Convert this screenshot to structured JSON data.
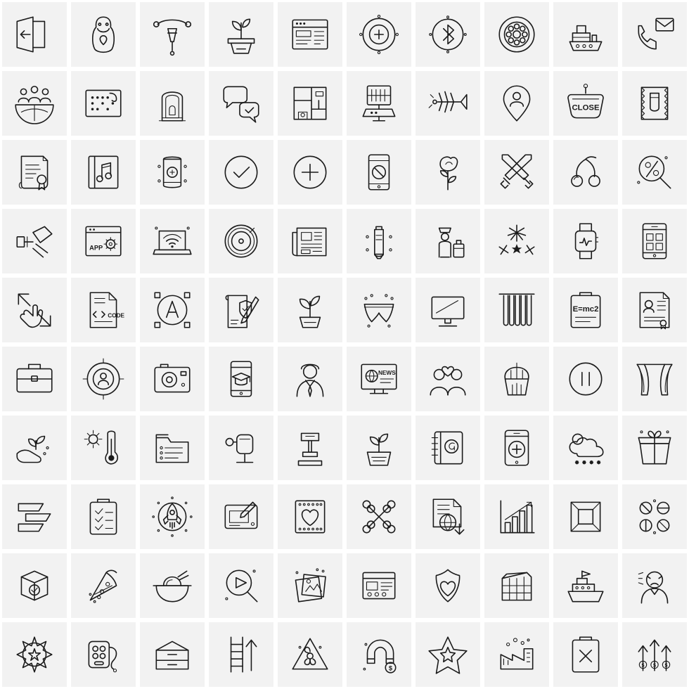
{
  "sheet": {
    "title": "Line Icon Set",
    "columns": 10,
    "rows": 10,
    "cell_background": "#f2f2f2",
    "page_background": "#ffffff",
    "stroke_color": "#1b1b1b",
    "icons": [
      {
        "row": 1,
        "col": 1,
        "name": "exit-left-arrow-icon",
        "label": "Exit Left Arrow"
      },
      {
        "row": 1,
        "col": 2,
        "name": "matryoshka-doll-icon",
        "label": "Matryoshka Doll"
      },
      {
        "row": 1,
        "col": 3,
        "name": "pen-tool-node-icon",
        "label": "Pen Tool Node"
      },
      {
        "row": 1,
        "col": 4,
        "name": "potted-plant-icon",
        "label": "Potted Plant"
      },
      {
        "row": 1,
        "col": 5,
        "name": "browser-window-icon",
        "label": "Browser Window"
      },
      {
        "row": 1,
        "col": 6,
        "name": "add-circle-target-icon",
        "label": "Add Circle Target"
      },
      {
        "row": 1,
        "col": 7,
        "name": "bluetooth-icon",
        "label": "Bluetooth"
      },
      {
        "row": 1,
        "col": 8,
        "name": "flower-circle-icon",
        "label": "Flower Circle"
      },
      {
        "row": 1,
        "col": 9,
        "name": "ship-icon",
        "label": "Ship"
      },
      {
        "row": 1,
        "col": 10,
        "name": "phone-mail-icon",
        "label": "Phone Mail"
      },
      {
        "row": 2,
        "col": 1,
        "name": "global-team-icon",
        "label": "Global Team"
      },
      {
        "row": 2,
        "col": 2,
        "name": "braille-card-icon",
        "label": "Braille Card"
      },
      {
        "row": 2,
        "col": 3,
        "name": "prayer-rug-icon",
        "label": "Prayer Rug"
      },
      {
        "row": 2,
        "col": 4,
        "name": "chat-approved-icon",
        "label": "Chat Approved"
      },
      {
        "row": 2,
        "col": 5,
        "name": "floor-plan-icon",
        "label": "Floor Plan"
      },
      {
        "row": 2,
        "col": 6,
        "name": "server-rack-icon",
        "label": "Server Rack"
      },
      {
        "row": 2,
        "col": 7,
        "name": "fish-bone-icon",
        "label": "Fish Bone"
      },
      {
        "row": 2,
        "col": 8,
        "name": "user-location-pin-icon",
        "label": "User Location Pin"
      },
      {
        "row": 2,
        "col": 9,
        "name": "close-sign-icon",
        "label": "Close Sign",
        "text": "CLOSE"
      },
      {
        "row": 2,
        "col": 10,
        "name": "condom-pack-icon",
        "label": "Condom Pack"
      },
      {
        "row": 3,
        "col": 1,
        "name": "certificate-scroll-icon",
        "label": "Certificate Scroll"
      },
      {
        "row": 3,
        "col": 2,
        "name": "music-book-icon",
        "label": "Music Book"
      },
      {
        "row": 3,
        "col": 3,
        "name": "soda-can-icon",
        "label": "Soda Can"
      },
      {
        "row": 3,
        "col": 4,
        "name": "check-circle-icon",
        "label": "Check Circle"
      },
      {
        "row": 3,
        "col": 5,
        "name": "plus-circle-icon",
        "label": "Plus Circle"
      },
      {
        "row": 3,
        "col": 6,
        "name": "phone-blocked-icon",
        "label": "Phone Blocked"
      },
      {
        "row": 3,
        "col": 7,
        "name": "rose-flower-icon",
        "label": "Rose Flower"
      },
      {
        "row": 3,
        "col": 8,
        "name": "crossed-swords-icon",
        "label": "Crossed Swords"
      },
      {
        "row": 3,
        "col": 9,
        "name": "cherries-icon",
        "label": "Cherries"
      },
      {
        "row": 3,
        "col": 10,
        "name": "discount-search-icon",
        "label": "Discount Search"
      },
      {
        "row": 4,
        "col": 1,
        "name": "paint-roller-icon",
        "label": "Paint Roller"
      },
      {
        "row": 4,
        "col": 2,
        "name": "app-settings-icon",
        "label": "App Settings",
        "text": "APP"
      },
      {
        "row": 4,
        "col": 3,
        "name": "laptop-wifi-icon",
        "label": "Laptop Wifi"
      },
      {
        "row": 4,
        "col": 4,
        "name": "vinyl-record-icon",
        "label": "Vinyl Record"
      },
      {
        "row": 4,
        "col": 5,
        "name": "newspaper-icon",
        "label": "Newspaper"
      },
      {
        "row": 4,
        "col": 6,
        "name": "cream-tube-icon",
        "label": "Cream Tube"
      },
      {
        "row": 4,
        "col": 7,
        "name": "traveler-luggage-icon",
        "label": "Traveler with Luggage"
      },
      {
        "row": 4,
        "col": 8,
        "name": "fireworks-icon",
        "label": "Fireworks"
      },
      {
        "row": 4,
        "col": 9,
        "name": "smart-watch-icon",
        "label": "Smart Watch"
      },
      {
        "row": 4,
        "col": 10,
        "name": "mobile-shop-icon",
        "label": "Mobile Shop"
      },
      {
        "row": 5,
        "col": 1,
        "name": "pinch-zoom-gesture-icon",
        "label": "Pinch Zoom Gesture"
      },
      {
        "row": 5,
        "col": 2,
        "name": "code-file-icon",
        "label": "Code File",
        "text": "CODE"
      },
      {
        "row": 5,
        "col": 3,
        "name": "font-vector-icon",
        "label": "Font Vector",
        "text": "A"
      },
      {
        "row": 5,
        "col": 4,
        "name": "secure-document-pen-icon",
        "label": "Secure Document with Pen"
      },
      {
        "row": 5,
        "col": 5,
        "name": "growing-plant-icon",
        "label": "Growing Plant"
      },
      {
        "row": 5,
        "col": 6,
        "name": "underwear-icon",
        "label": "Underwear"
      },
      {
        "row": 5,
        "col": 7,
        "name": "desktop-monitor-icon",
        "label": "Desktop Monitor"
      },
      {
        "row": 5,
        "col": 8,
        "name": "curtain-blinds-icon",
        "label": "Curtain Blinds"
      },
      {
        "row": 5,
        "col": 9,
        "name": "physics-clipboard-icon",
        "label": "Physics Clipboard",
        "text": "E=mc2"
      },
      {
        "row": 5,
        "col": 10,
        "name": "resume-document-icon",
        "label": "Resume Document"
      },
      {
        "row": 6,
        "col": 1,
        "name": "briefcase-icon",
        "label": "Briefcase"
      },
      {
        "row": 6,
        "col": 2,
        "name": "target-audience-icon",
        "label": "Target Audience"
      },
      {
        "row": 6,
        "col": 3,
        "name": "vintage-camera-icon",
        "label": "Vintage Camera"
      },
      {
        "row": 6,
        "col": 4,
        "name": "mobile-graduation-icon",
        "label": "Mobile Graduation"
      },
      {
        "row": 6,
        "col": 5,
        "name": "businessman-avatar-icon",
        "label": "Businessman Avatar"
      },
      {
        "row": 6,
        "col": 6,
        "name": "news-monitor-icon",
        "label": "News Monitor",
        "text": "NEWS"
      },
      {
        "row": 6,
        "col": 7,
        "name": "couple-love-icon",
        "label": "Couple in Love"
      },
      {
        "row": 6,
        "col": 8,
        "name": "cupcake-icon",
        "label": "Cupcake"
      },
      {
        "row": 6,
        "col": 9,
        "name": "pause-circle-icon",
        "label": "Pause Circle"
      },
      {
        "row": 6,
        "col": 10,
        "name": "stage-curtain-icon",
        "label": "Stage Curtain"
      },
      {
        "row": 7,
        "col": 1,
        "name": "hand-plant-care-icon",
        "label": "Hand Plant Care"
      },
      {
        "row": 7,
        "col": 2,
        "name": "thermometer-sun-icon",
        "label": "Thermometer Sun"
      },
      {
        "row": 7,
        "col": 3,
        "name": "checklist-folder-icon",
        "label": "Checklist Folder"
      },
      {
        "row": 7,
        "col": 4,
        "name": "blood-bag-stand-icon",
        "label": "Blood Bag Stand"
      },
      {
        "row": 7,
        "col": 5,
        "name": "gavel-auction-icon",
        "label": "Gavel Auction"
      },
      {
        "row": 7,
        "col": 6,
        "name": "plant-pot-sprout-icon",
        "label": "Plant Pot Sprout"
      },
      {
        "row": 7,
        "col": 7,
        "name": "address-book-icon",
        "label": "Address Book"
      },
      {
        "row": 7,
        "col": 8,
        "name": "mobile-medical-icon",
        "label": "Mobile Medical"
      },
      {
        "row": 7,
        "col": 9,
        "name": "cloud-snow-icon",
        "label": "Cloud Snow"
      },
      {
        "row": 7,
        "col": 10,
        "name": "gift-box-icon",
        "label": "Gift Box"
      },
      {
        "row": 8,
        "col": 1,
        "name": "zigzag-stairs-icon",
        "label": "Zigzag Stairs"
      },
      {
        "row": 8,
        "col": 2,
        "name": "clipboard-checklist-icon",
        "label": "Clipboard Checklist"
      },
      {
        "row": 8,
        "col": 3,
        "name": "rocket-launch-circle-icon",
        "label": "Rocket Launch Circle"
      },
      {
        "row": 8,
        "col": 4,
        "name": "design-tablet-icon",
        "label": "Design Tablet"
      },
      {
        "row": 8,
        "col": 5,
        "name": "love-card-icon",
        "label": "Love Card"
      },
      {
        "row": 8,
        "col": 6,
        "name": "crossed-bones-icon",
        "label": "Crossed Bones"
      },
      {
        "row": 8,
        "col": 7,
        "name": "global-document-icon",
        "label": "Global Document"
      },
      {
        "row": 8,
        "col": 8,
        "name": "growth-bar-chart-icon",
        "label": "Growth Bar Chart"
      },
      {
        "row": 8,
        "col": 9,
        "name": "framed-picture-icon",
        "label": "Framed Picture"
      },
      {
        "row": 8,
        "col": 10,
        "name": "pills-medicine-icon",
        "label": "Pills Medicine"
      },
      {
        "row": 9,
        "col": 1,
        "name": "verified-package-icon",
        "label": "Verified Package"
      },
      {
        "row": 9,
        "col": 2,
        "name": "pizza-slice-icon",
        "label": "Pizza Slice"
      },
      {
        "row": 9,
        "col": 3,
        "name": "noodle-bowl-icon",
        "label": "Noodle Bowl"
      },
      {
        "row": 9,
        "col": 4,
        "name": "video-search-icon",
        "label": "Video Search"
      },
      {
        "row": 9,
        "col": 5,
        "name": "photo-gallery-icon",
        "label": "Photo Gallery"
      },
      {
        "row": 9,
        "col": 6,
        "name": "web-layout-icon",
        "label": "Web Layout"
      },
      {
        "row": 9,
        "col": 7,
        "name": "heart-shield-icon",
        "label": "Heart Shield"
      },
      {
        "row": 9,
        "col": 8,
        "name": "apartment-building-icon",
        "label": "Apartment Building"
      },
      {
        "row": 9,
        "col": 9,
        "name": "cruise-ship-icon",
        "label": "Cruise Ship"
      },
      {
        "row": 9,
        "col": 10,
        "name": "angry-man-icon",
        "label": "Angry Man"
      },
      {
        "row": 10,
        "col": 1,
        "name": "sheriff-badge-icon",
        "label": "Sheriff Badge"
      },
      {
        "row": 10,
        "col": 2,
        "name": "game-controller-icon",
        "label": "Game Controller"
      },
      {
        "row": 10,
        "col": 3,
        "name": "drawer-cabinet-icon",
        "label": "Drawer Cabinet"
      },
      {
        "row": 10,
        "col": 4,
        "name": "ladder-up-arrow-icon",
        "label": "Ladder Up Arrow"
      },
      {
        "row": 10,
        "col": 5,
        "name": "biohazard-warning-icon",
        "label": "Biohazard Warning"
      },
      {
        "row": 10,
        "col": 6,
        "name": "magnet-money-icon",
        "label": "Magnet Money",
        "text": "$"
      },
      {
        "row": 10,
        "col": 7,
        "name": "star-favorite-icon",
        "label": "Star Favorite"
      },
      {
        "row": 10,
        "col": 8,
        "name": "factory-pollution-icon",
        "label": "Factory Pollution"
      },
      {
        "row": 10,
        "col": 9,
        "name": "clipboard-cross-icon",
        "label": "Clipboard Cross"
      },
      {
        "row": 10,
        "col": 10,
        "name": "money-growth-arrows-icon",
        "label": "Money Growth Arrows",
        "text": "$"
      }
    ]
  }
}
